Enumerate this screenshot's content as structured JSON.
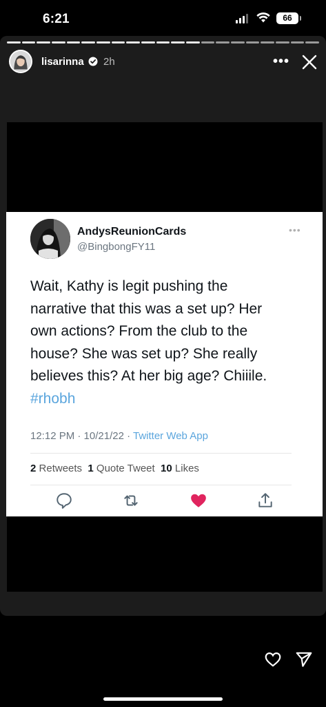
{
  "status_bar": {
    "time": "6:21",
    "battery": "66"
  },
  "story": {
    "username": "lisarinna",
    "time_ago": "2h",
    "more_label": "•••"
  },
  "tweet": {
    "display_name": "AndysReunionCards",
    "handle": "@BingbongFY11",
    "more_label": "•••",
    "body_lines": [
      "Wait, Kathy is legit pushing the",
      "narrative that this was a set up? Her",
      "own actions? From the club to the",
      "house? She was set up? She really",
      "believes this? At her big age? Chiiile."
    ],
    "hashtag": "#rhobh",
    "timestamp": "12:12 PM · 10/21/22 · ",
    "app": "Twitter Web App",
    "retweets_count": "2",
    "retweets_label": "Retweets",
    "quotes_count": "1",
    "quotes_label": "Quote Tweet",
    "likes_count": "10",
    "likes_label": "Likes"
  },
  "colors": {
    "like_active": "#e0245e",
    "link": "#5aa5dd"
  }
}
